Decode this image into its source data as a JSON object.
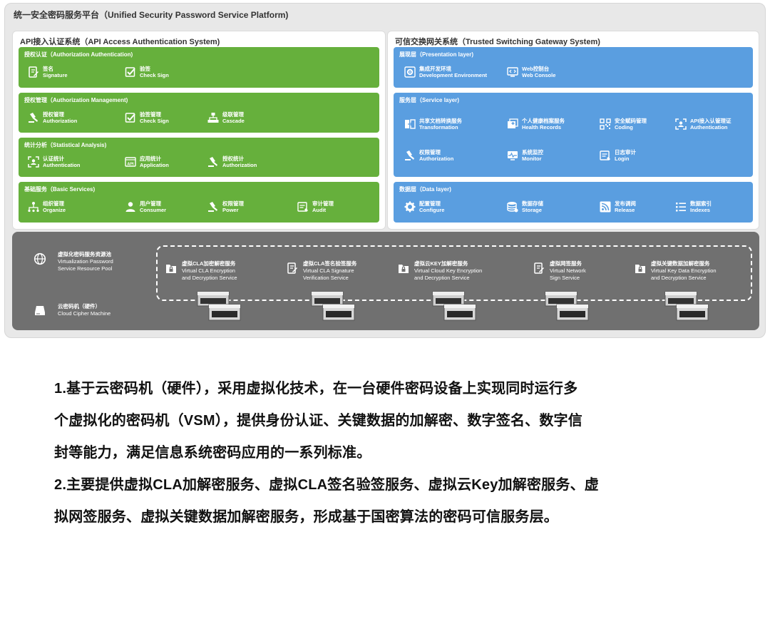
{
  "platform_title": "统一安全密码服务平台（Unified Security Password Service Platform)",
  "left_system": {
    "title": "API接入认证系统（API Access Authentication System)",
    "layers": [
      {
        "title": "授权认证（Authorization  Authentication)",
        "items": [
          {
            "cn": "签名",
            "en": "Signature",
            "icon": "signature-icon"
          },
          {
            "cn": "验签",
            "en": "Check Sign",
            "icon": "check-sign-icon"
          }
        ]
      },
      {
        "title": "授权管理（Authorization  Management)",
        "items": [
          {
            "cn": "授权管理",
            "en": "Authorization",
            "icon": "gavel-icon"
          },
          {
            "cn": "验签管理",
            "en": "Check Sign",
            "icon": "check-sign-icon"
          },
          {
            "cn": "级联管理",
            "en": "Cascade",
            "icon": "cascade-icon"
          }
        ]
      },
      {
        "title": "统计分析（Statistical Analysis)",
        "items": [
          {
            "cn": "认证统计",
            "en": "Authentication",
            "icon": "auth-scan-icon"
          },
          {
            "cn": "应用统计",
            "en": "Application",
            "icon": "api-icon"
          },
          {
            "cn": "授权统计",
            "en": "Authorization",
            "icon": "gavel-icon"
          }
        ]
      },
      {
        "title": "基础服务（Basic Services)",
        "items": [
          {
            "cn": "组织管理",
            "en": "Organize",
            "icon": "org-icon"
          },
          {
            "cn": "用户管理",
            "en": "Consumer",
            "icon": "user-icon"
          },
          {
            "cn": "权限管理",
            "en": "Power",
            "icon": "gavel-icon"
          },
          {
            "cn": "审计管理",
            "en": "Audit",
            "icon": "audit-icon"
          }
        ]
      }
    ]
  },
  "right_system": {
    "title": "可信交换网关系统（Trusted Switching Gateway System)",
    "layers": [
      {
        "title": "展现层（Presentation layer)",
        "items": [
          {
            "cn": "集成开发环境",
            "en": "Development Environment",
            "icon": "gear-box-icon"
          },
          {
            "cn": "Web控制台",
            "en": "Web Console",
            "icon": "code-monitor-icon"
          }
        ]
      },
      {
        "title": "服务层（Service layer)",
        "items": [
          {
            "cn": "共享文档转换服务",
            "en": "Transformation",
            "icon": "transform-icon"
          },
          {
            "cn": "个人健康档案服务",
            "en": "Health Records",
            "icon": "health-icon"
          },
          {
            "cn": "安全赋码管理",
            "en": "Coding",
            "icon": "qr-icon"
          },
          {
            "cn": "API接入认管理证",
            "en": "Authentication",
            "icon": "auth-scan-icon"
          },
          {
            "cn": "权限管理",
            "en": "Authorization",
            "icon": "gavel-icon"
          },
          {
            "cn": "系统监控",
            "en": "Monitor",
            "icon": "monitor-icon"
          },
          {
            "cn": "日志审计",
            "en": "Login",
            "icon": "audit-icon"
          }
        ]
      },
      {
        "title": "数据层（Data layer)",
        "items": [
          {
            "cn": "配置管理",
            "en": "Configure",
            "icon": "gear-icon"
          },
          {
            "cn": "数据存储",
            "en": "Storage",
            "icon": "database-icon"
          },
          {
            "cn": "发布调阅",
            "en": "Release",
            "icon": "rss-icon"
          },
          {
            "cn": "数据索引",
            "en": "Indexes",
            "icon": "list-icon"
          }
        ]
      }
    ]
  },
  "pool": {
    "resource_pool": {
      "cn": "虚拟化密码服务资源池",
      "en1": "Virtualization Password",
      "en2": "Service Resource Pool"
    },
    "machine": {
      "cn": "云密码机（硬件）",
      "en": "Cloud Cipher Machine"
    },
    "services": [
      {
        "cn": "虚拟CLA加密解密服务",
        "en1": "Virtual CLA Encryption",
        "en2": "and Decryption Service",
        "icon": "lock-folder-icon"
      },
      {
        "cn": "虚拟CLA签名验签服务",
        "en1": "Virtual CLA Signature",
        "en2": "Verification Service",
        "icon": "signature-icon"
      },
      {
        "cn": "虚拟云KEY加解密服务",
        "en1": "Virtual Cloud Key Encryption",
        "en2": "and Decryption Service",
        "icon": "lock-folder-icon"
      },
      {
        "cn": "虚拟网签服务",
        "en1": "Virtual Network",
        "en2": "Sign Service",
        "icon": "signature-icon"
      },
      {
        "cn": "虚拟关键数据加解密服务",
        "en1": "Virtual Key Data Encryption",
        "en2": "and Decryption Service",
        "icon": "lock-folder-icon"
      }
    ]
  },
  "description": {
    "p1_line1": "1.基于云密码机（硬件），采用虚拟化技术，在一台硬件密码设备上实现同时运行多",
    "p1_line2": "个虚拟化的密码机（VSM），提供身份认证、关键数据的加解密、数字签名、数字信",
    "p1_line3": "封等能力，满足信息系统密码应用的一系列标准。",
    "p2_line1": "2.主要提供虚拟CLA加解密服务、虚拟CLA签名验签服务、虚拟云Key加解密服务、虚",
    "p2_line2": "拟网签服务、虚拟关键数据加解密服务，形成基于国密算法的密码可信服务层。"
  }
}
